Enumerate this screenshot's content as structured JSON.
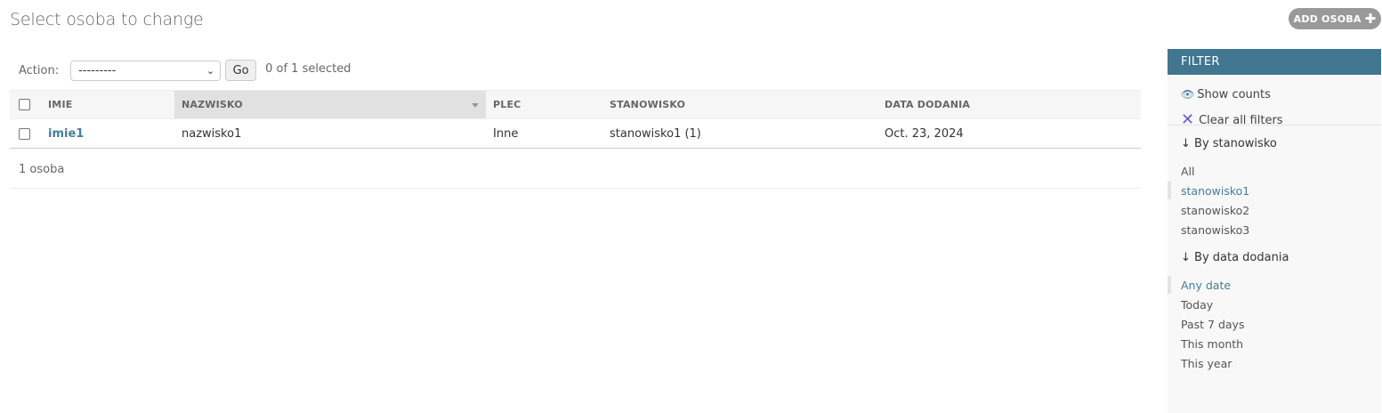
{
  "header": {
    "title": "Select osoba to change",
    "add_button": "ADD OSOBA"
  },
  "actions": {
    "label": "Action:",
    "select_value": "---------",
    "go_label": "Go",
    "counter": "0 of 1 selected"
  },
  "table": {
    "columns": [
      "IMIE",
      "NAZWISKO",
      "PLEC",
      "STANOWISKO",
      "DATA DODANIA"
    ],
    "sorted_column": "NAZWISKO",
    "rows": [
      {
        "imie": "imie1",
        "nazwisko": "nazwisko1",
        "plec": "Inne",
        "stanowisko": "stanowisko1 (1)",
        "data_dodania": "Oct. 23, 2024"
      }
    ]
  },
  "paginator": {
    "text": "1 osoba"
  },
  "filter": {
    "title": "FILTER",
    "show_counts": "Show counts",
    "clear_all": "Clear all filters",
    "groups": [
      {
        "title": "↓ By stanowisko",
        "options": [
          "All",
          "stanowisko1",
          "stanowisko2",
          "stanowisko3"
        ],
        "selected": "stanowisko1"
      },
      {
        "title": "↓ By data dodania",
        "options": [
          "Any date",
          "Today",
          "Past 7 days",
          "This month",
          "This year"
        ],
        "selected": "Any date"
      }
    ]
  },
  "colors": {
    "filter_header": "#417690",
    "link": "#447e9b",
    "add_button": "#999999"
  }
}
